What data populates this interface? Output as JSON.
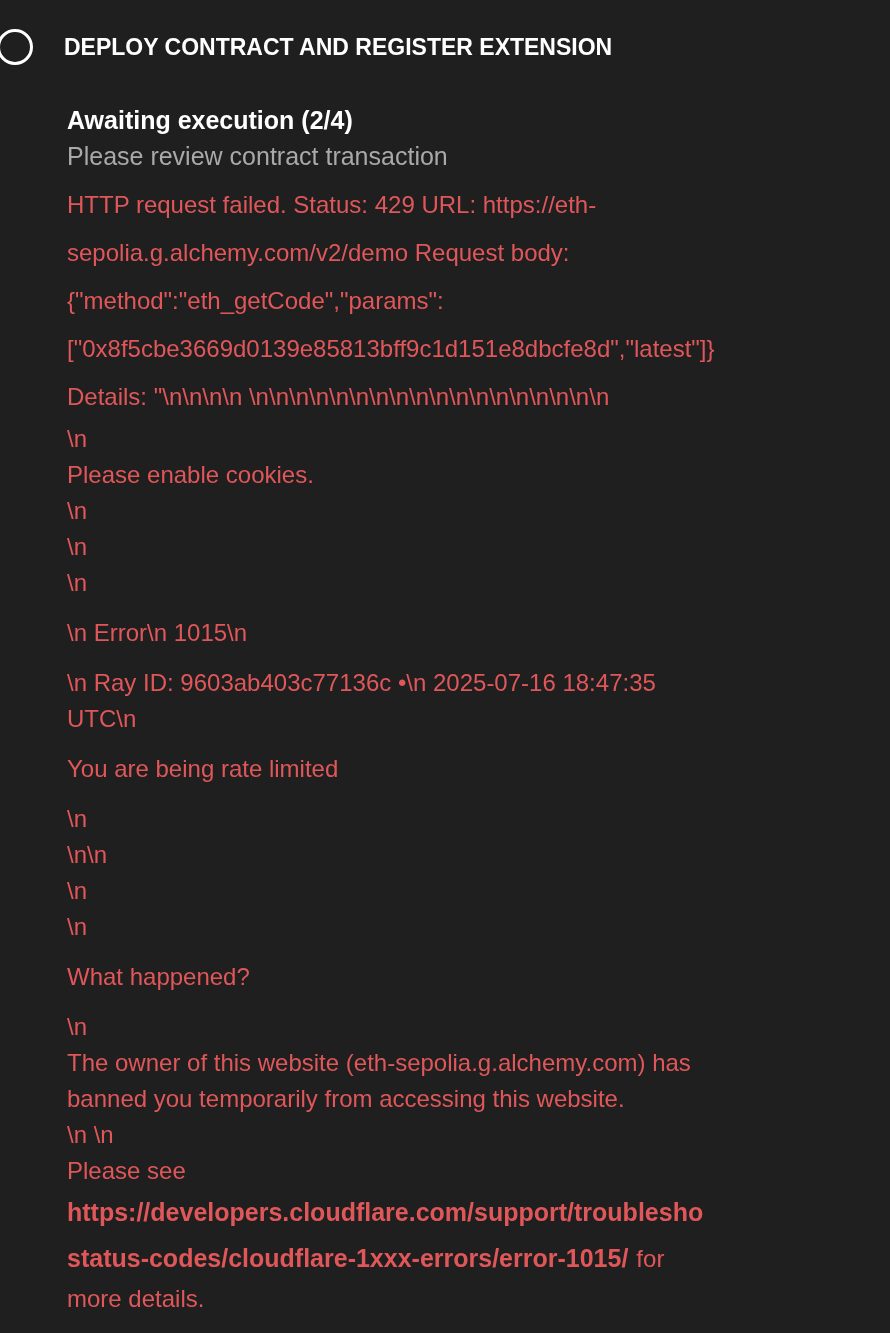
{
  "step": {
    "title": "DEPLOY CONTRACT AND REGISTER EXTENSION",
    "status": "Awaiting execution (2/4)",
    "subtitle": "Please review contract transaction"
  },
  "message": [
    {
      "kind": "loose",
      "lines": [
        "HTTP request failed. Status: 429 URL: https://eth-",
        "sepolia.g.alchemy.com/v2/demo Request body:",
        "{\"method\":\"eth_getCode\",\"params\":",
        "[\"0x8f5cbe3669d0139e85813bff9c1d151e8dbcfe8d\",\"latest\"]}",
        "Details: \"\\n\\n\\n\\n \\n\\n\\n\\n\\n\\n\\n\\n\\n\\n\\n\\n\\n\\n\\n\\n\\n\\n"
      ]
    },
    {
      "kind": "tight",
      "lines": [
        "\\n",
        "Please enable cookies.",
        "\\n",
        "\\n",
        "\\n"
      ]
    },
    {
      "kind": "para",
      "lines": [
        "\\n Error\\n 1015\\n"
      ]
    },
    {
      "kind": "para",
      "lines": [
        "\\n Ray ID: 9603ab403c77136c •\\n 2025-07-16 18:47:35",
        "UTC\\n"
      ]
    },
    {
      "kind": "para",
      "lines": [
        "You are being rate limited"
      ]
    },
    {
      "kind": "para",
      "lines": [
        "\\n",
        "\\n\\n",
        "\\n",
        "\\n"
      ]
    },
    {
      "kind": "para",
      "lines": [
        "What happened?"
      ]
    },
    {
      "kind": "para",
      "lines": [
        "\\n",
        "The owner of this website (eth-sepolia.g.alchemy.com) has",
        "banned you temporarily from accessing this website.",
        "\\n \\n",
        "Please see"
      ]
    },
    {
      "kind": "link",
      "links": [
        "https://developers.cloudflare.com/support/troublesho",
        "status-codes/cloudflare-1xxx-errors/error-1015/"
      ],
      "tail": "for",
      "end": "more details."
    }
  ]
}
